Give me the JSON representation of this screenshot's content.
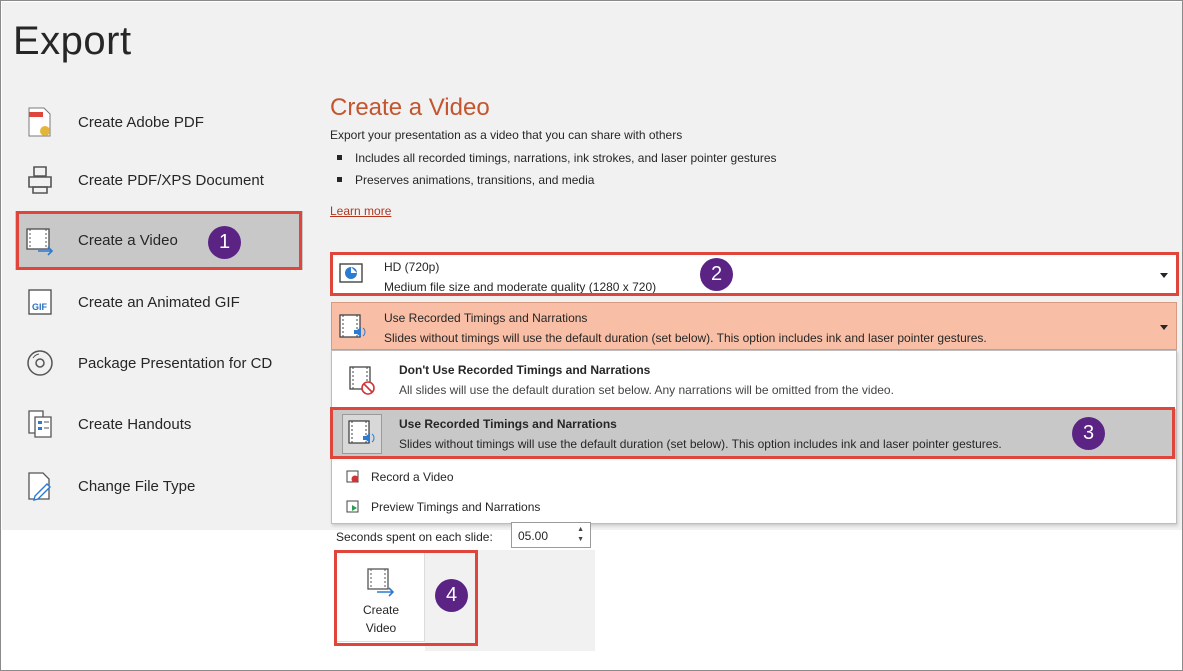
{
  "page": {
    "title": "Export"
  },
  "sidebar": {
    "items": [
      {
        "label": "Create Adobe PDF",
        "icon": "adobe-pdf-icon"
      },
      {
        "label": "Create PDF/XPS Document",
        "icon": "pdf-xps-icon"
      },
      {
        "label": "Create a Video",
        "icon": "video-icon",
        "selected": true
      },
      {
        "label": "Create an Animated GIF",
        "icon": "gif-icon"
      },
      {
        "label": "Package Presentation for CD",
        "icon": "cd-icon"
      },
      {
        "label": "Create Handouts",
        "icon": "handouts-icon"
      },
      {
        "label": "Change File Type",
        "icon": "change-file-type-icon"
      }
    ]
  },
  "main": {
    "heading": "Create a Video",
    "description": "Export your presentation as a video that you can share with others",
    "bullets": [
      "Includes all recorded timings, narrations, ink strokes, and laser pointer gestures",
      "Preserves animations, transitions, and media"
    ],
    "learn_more": "Learn more",
    "quality_dropdown": {
      "title": "HD (720p)",
      "subtitle": "Medium file size and moderate quality (1280 x 720)"
    },
    "timings_dropdown": {
      "title": "Use Recorded Timings and Narrations",
      "subtitle": "Slides without timings will use the default duration (set below). This option includes ink and laser pointer gestures."
    },
    "menu": {
      "options": [
        {
          "title": "Don't Use Recorded Timings and Narrations",
          "subtitle": "All slides will use the default duration set below. Any narrations will be omitted from the video."
        },
        {
          "title": "Use Recorded Timings and Narrations",
          "subtitle": "Slides without timings will use the default duration (set below). This option includes ink and laser pointer gestures.",
          "selected": true
        }
      ],
      "actions": [
        {
          "label": "Record a Video",
          "icon": "record-icon"
        },
        {
          "label": "Preview Timings and Narrations",
          "icon": "preview-icon"
        }
      ]
    },
    "seconds": {
      "label": "Seconds spent on each slide:",
      "value": "05.00"
    },
    "create_button": {
      "line1": "Create",
      "line2": "Video"
    }
  },
  "annotations": {
    "badge1": "1",
    "badge2": "2",
    "badge3": "3",
    "badge4": "4"
  },
  "colors": {
    "accent": "#c4552e",
    "highlight": "#e0453b",
    "badge": "#5a2384",
    "selected_bg": "#f8bfa6"
  }
}
